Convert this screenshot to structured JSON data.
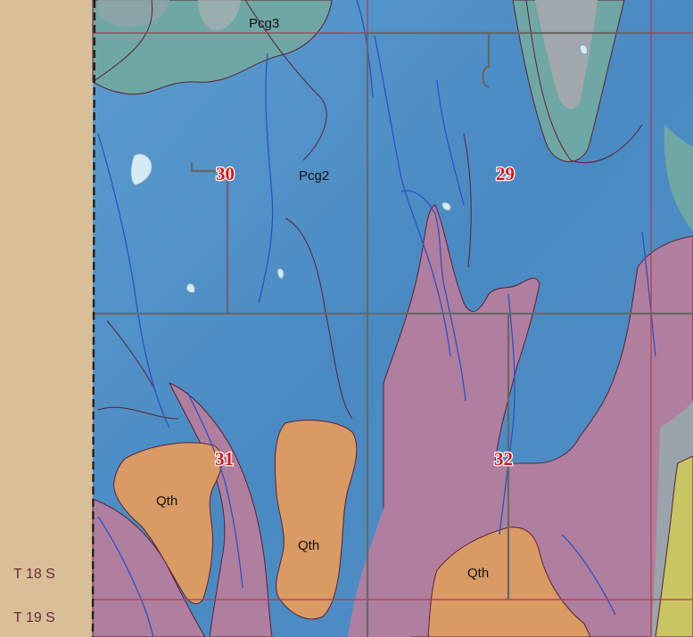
{
  "map": {
    "colors": {
      "margin": "#d8bf98",
      "pcg2": "#4f90c6",
      "pcg3": "#6fa7a4",
      "qth": "#d99a64",
      "pink_unit": "#b07f9f",
      "gray_unit": "#9aa4aa",
      "yellow_unit": "#c9c562",
      "section_line": "#b0384e",
      "road": "#676767",
      "stream": "#2a52c4",
      "contact": "#5a2030",
      "water": "#d5eaf5"
    },
    "unit_labels": {
      "pcg3": "Pcg3",
      "pcg2": "Pcg2",
      "qth_1": "Qth",
      "qth_2": "Qth",
      "qth_3": "Qth"
    },
    "sections": {
      "s30": "30",
      "s29": "29",
      "s31": "31",
      "s32": "32"
    },
    "township_labels": {
      "north": "T 18 S",
      "south": "T 19 S"
    }
  }
}
